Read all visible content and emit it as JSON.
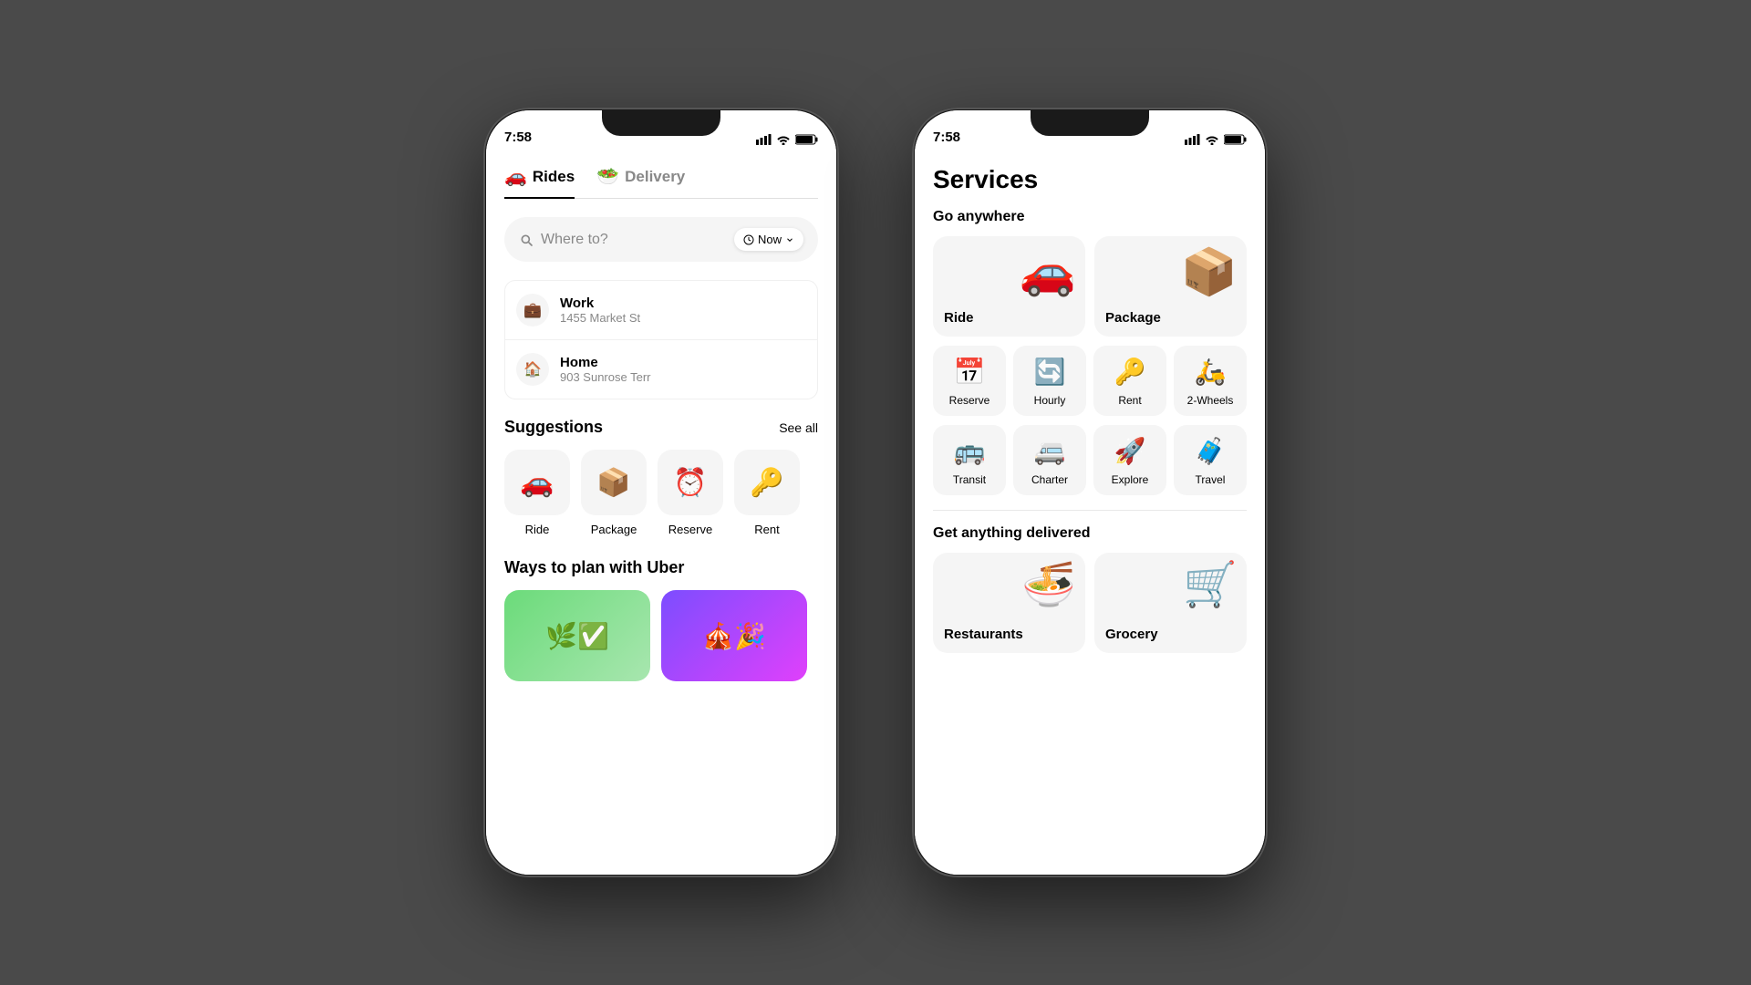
{
  "background": "#4a4a4a",
  "phone_left": {
    "status": {
      "time": "7:58"
    },
    "tabs": [
      {
        "label": "Rides",
        "emoji": "🚗",
        "active": true
      },
      {
        "label": "Delivery",
        "emoji": "🥗",
        "active": false
      }
    ],
    "search": {
      "placeholder": "Where to?",
      "now_label": "Now"
    },
    "saved_locations": [
      {
        "icon": "💼",
        "label": "Work",
        "address": "1455 Market St"
      },
      {
        "icon": "🏠",
        "label": "Home",
        "address": "903 Sunrose Terr"
      }
    ],
    "suggestions": {
      "title": "Suggestions",
      "see_all": "See all",
      "items": [
        {
          "emoji": "🚗",
          "label": "Ride"
        },
        {
          "emoji": "📦",
          "label": "Package"
        },
        {
          "emoji": "⏰",
          "label": "Reserve"
        },
        {
          "emoji": "🔑",
          "label": "Rent"
        }
      ]
    },
    "ways": {
      "title": "Ways to plan with Uber"
    }
  },
  "phone_right": {
    "status": {
      "time": "7:58"
    },
    "title": "Services",
    "go_anywhere": {
      "title": "Go anywhere",
      "big_cards": [
        {
          "emoji": "🚗",
          "label": "Ride"
        },
        {
          "emoji": "📦",
          "label": "Package"
        }
      ],
      "row1": [
        {
          "emoji": "📅",
          "label": "Reserve"
        },
        {
          "emoji": "🔄",
          "label": "Hourly"
        },
        {
          "emoji": "🔑",
          "label": "Rent"
        },
        {
          "emoji": "🛵",
          "label": "2-Wheels"
        }
      ],
      "row2": [
        {
          "emoji": "🚌",
          "label": "Transit"
        },
        {
          "emoji": "🚐",
          "label": "Charter"
        },
        {
          "emoji": "🚀",
          "label": "Explore"
        },
        {
          "emoji": "🧳",
          "label": "Travel"
        }
      ]
    },
    "get_delivered": {
      "title": "Get anything delivered",
      "cards": [
        {
          "emoji": "🍜",
          "label": "Restaurants"
        },
        {
          "emoji": "🛒",
          "label": "Grocery"
        }
      ]
    }
  }
}
